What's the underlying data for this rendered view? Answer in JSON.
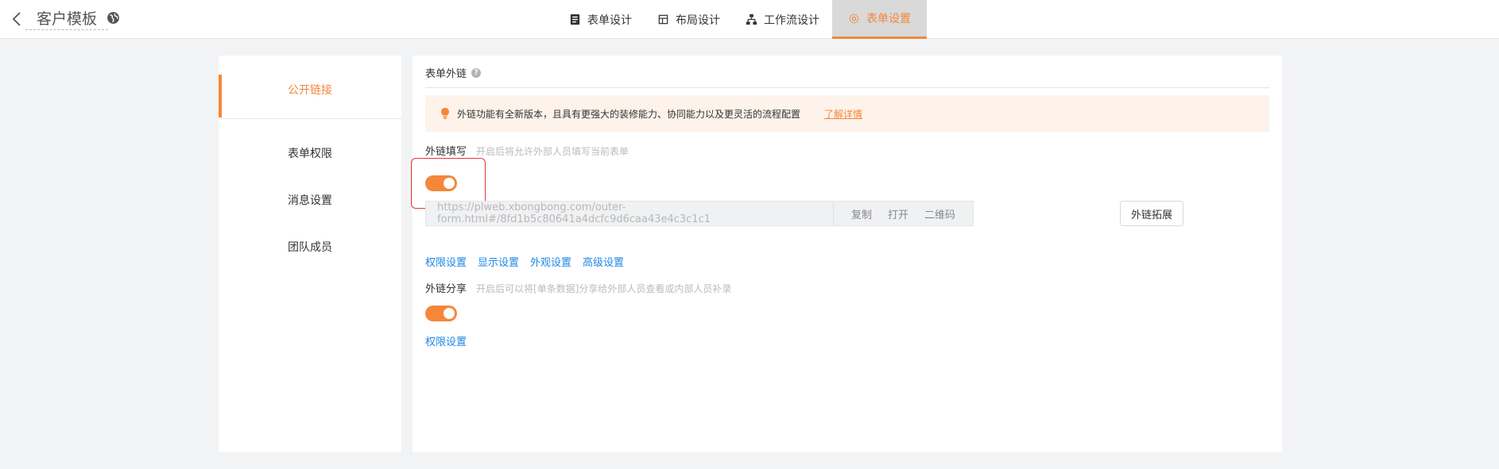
{
  "header": {
    "title": "客户模板",
    "tabs": [
      {
        "label": "表单设计",
        "icon": "form-icon"
      },
      {
        "label": "布局设计",
        "icon": "layout-icon"
      },
      {
        "label": "工作流设计",
        "icon": "workflow-icon"
      },
      {
        "label": "表单设置",
        "icon": "gear-icon",
        "active": true
      }
    ]
  },
  "sidebar": {
    "items": [
      {
        "label": "公开链接",
        "active": true
      },
      {
        "label": "表单权限"
      },
      {
        "label": "消息设置"
      },
      {
        "label": "团队成员"
      }
    ]
  },
  "main": {
    "section_title": "表单外链",
    "notice": {
      "text": "外链功能有全新版本，且具有更强大的装修能力、协同能力以及更灵活的流程配置",
      "link": "了解详情"
    },
    "fill": {
      "label": "外链填写",
      "hint": "开启后将允许外部人员填写当前表单",
      "enabled": true,
      "url": "https://plweb.xbongbong.com/outer-form.html#/8fd1b5c80641a4dcfc9d6caa43e4c3c1c1",
      "actions": {
        "copy": "复制",
        "open": "打开",
        "qrcode": "二维码"
      },
      "extend_button": "外链拓展",
      "links": [
        "权限设置",
        "显示设置",
        "外观设置",
        "高级设置"
      ]
    },
    "share": {
      "label": "外链分享",
      "hint": "开启后可以将[单条数据]分享给外部人员查看或内部人员补录",
      "enabled": true,
      "links": [
        "权限设置"
      ]
    }
  },
  "colors": {
    "accent": "#f5873a",
    "link": "#1e88e5",
    "highlight": "#e53935",
    "notice_bg": "#fdf3ea"
  }
}
